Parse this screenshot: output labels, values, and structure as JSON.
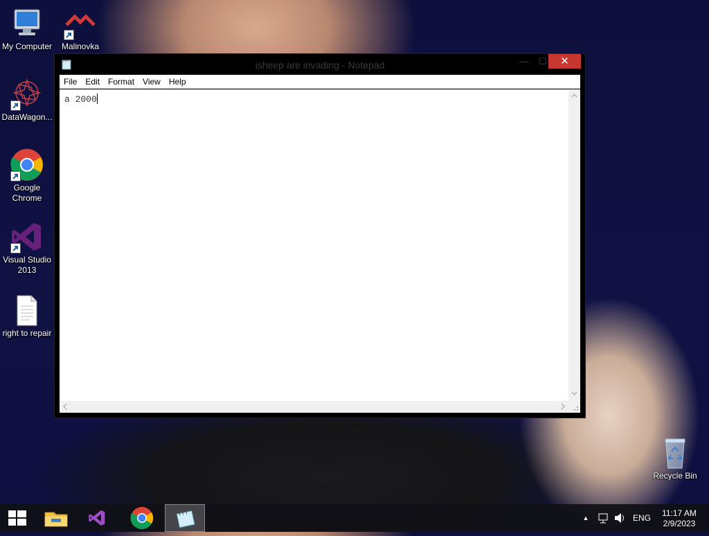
{
  "desktop": {
    "icons": [
      {
        "label": "My Computer"
      },
      {
        "label": "Malinovka"
      },
      {
        "label": "DataWagon..."
      },
      {
        "label": "Google Chrome"
      },
      {
        "label": "Visual Studio 2013"
      },
      {
        "label": "right to repair"
      },
      {
        "label": "Recycle Bin"
      }
    ]
  },
  "window": {
    "title": "isheep are invading - Notepad",
    "menu": [
      "File",
      "Edit",
      "Format",
      "View",
      "Help"
    ],
    "content": "a 2000",
    "minimize_glyph": "—",
    "maximize_glyph": "☐",
    "close_glyph": "✕"
  },
  "taskbar": {
    "pinned": [
      "file-explorer-icon",
      "visual-studio-icon",
      "chrome-icon",
      "notepad-icon"
    ],
    "language": "ENG",
    "time": "11:17 AM",
    "date": "2/9/2023",
    "tray_arrow": "▲"
  },
  "colors": {
    "close_button": "#c7372f",
    "desktop_bg": "#0d0f3c",
    "taskbar": "#101016"
  }
}
